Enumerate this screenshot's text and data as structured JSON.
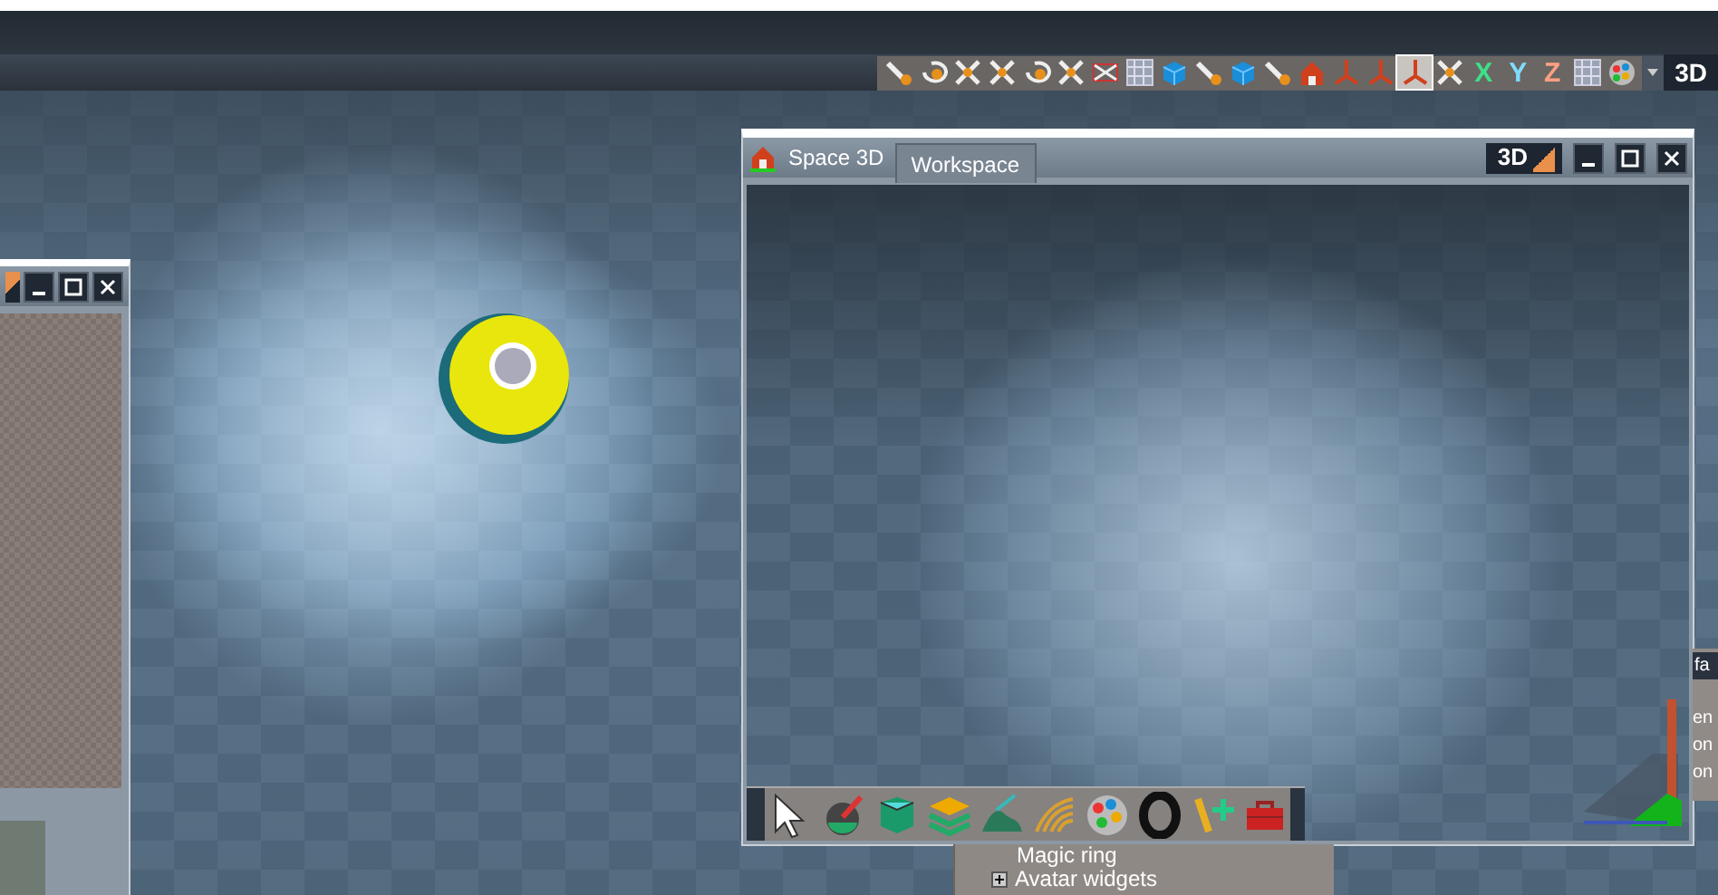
{
  "top_toolbar": {
    "tools": [
      {
        "kind": "wand",
        "selected": false
      },
      {
        "kind": "rotate",
        "selected": false
      },
      {
        "kind": "cross",
        "selected": false
      },
      {
        "kind": "cross",
        "selected": false
      },
      {
        "kind": "rotate",
        "selected": false
      },
      {
        "kind": "cross",
        "selected": false
      },
      {
        "kind": "frame",
        "selected": false
      },
      {
        "kind": "grid",
        "selected": false
      },
      {
        "kind": "cube",
        "selected": false
      },
      {
        "kind": "wand",
        "selected": false
      },
      {
        "kind": "cube",
        "selected": false
      },
      {
        "kind": "wand",
        "selected": false
      },
      {
        "kind": "house",
        "selected": false
      },
      {
        "kind": "axes",
        "selected": false
      },
      {
        "kind": "axes",
        "selected": false
      },
      {
        "kind": "axes",
        "selected": true
      },
      {
        "kind": "cross",
        "selected": false
      },
      {
        "kind": "letter",
        "label": "X",
        "selected": false
      },
      {
        "kind": "letter",
        "label": "Y",
        "selected": false
      },
      {
        "kind": "letter",
        "label": "Z",
        "selected": false
      },
      {
        "kind": "grid",
        "selected": false
      },
      {
        "kind": "palette",
        "selected": false
      }
    ],
    "mode": "3D"
  },
  "left_window": {
    "mode_corner": true
  },
  "space_window": {
    "title": "Space 3D",
    "tabs": [
      {
        "label": "Workspace",
        "selected": true
      }
    ],
    "mode": "3D",
    "tools": [
      {
        "kind": "arrow"
      },
      {
        "kind": "brush"
      },
      {
        "kind": "cube"
      },
      {
        "kind": "layers"
      },
      {
        "kind": "terrain"
      },
      {
        "kind": "rake"
      },
      {
        "kind": "palette"
      },
      {
        "kind": "tire"
      },
      {
        "kind": "figure"
      },
      {
        "kind": "toolbox"
      }
    ]
  },
  "right_panel": {
    "header": "fa",
    "lines": [
      "en",
      "on",
      "on"
    ]
  },
  "bottom_panel": {
    "items": [
      {
        "label": "Magic ring",
        "expandable": false
      },
      {
        "label": "Avatar widgets",
        "expandable": true
      }
    ]
  }
}
